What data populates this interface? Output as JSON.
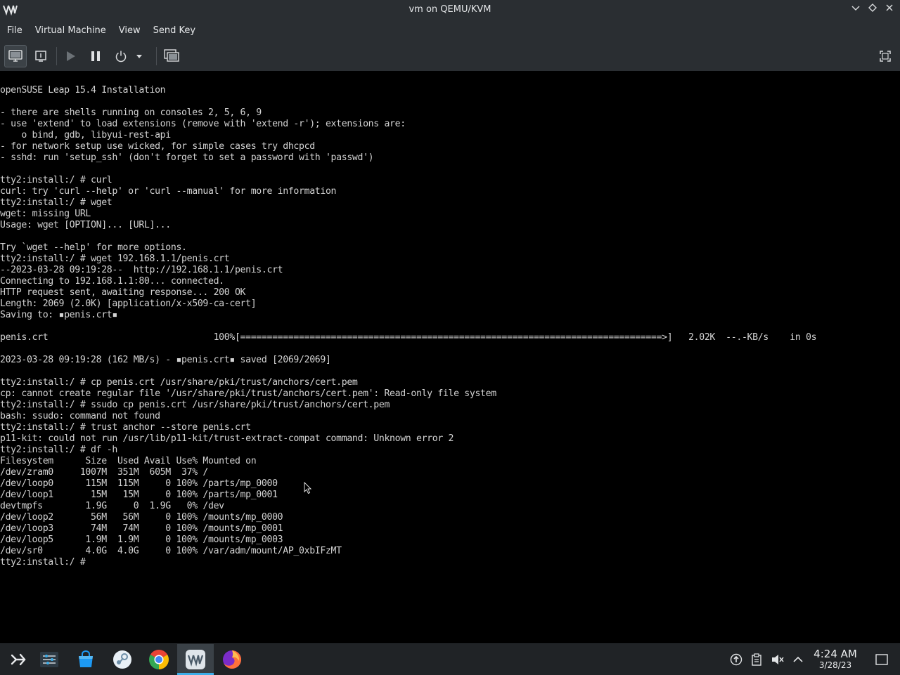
{
  "window": {
    "title": "vm on QEMU/KVM"
  },
  "menu": {
    "items": [
      "File",
      "Virtual Machine",
      "View",
      "Send Key"
    ]
  },
  "toolbar": {
    "buttons": [
      "console-view",
      "details-view",
      "run",
      "pause",
      "shutdown",
      "shutdown-menu",
      "snapshots",
      "fullscreen"
    ]
  },
  "console": {
    "lines": [
      "openSUSE Leap 15.4 Installation",
      "",
      "- there are shells running on consoles 2, 5, 6, 9",
      "- use 'extend' to load extensions (remove with 'extend -r'); extensions are:",
      "    o bind, gdb, libyui-rest-api",
      "- for network setup use wicked, for simple cases try dhcpcd",
      "- sshd: run 'setup_ssh' (don't forget to set a password with 'passwd')",
      "",
      "tty2:install:/ # curl",
      "curl: try 'curl --help' or 'curl --manual' for more information",
      "tty2:install:/ # wget",
      "wget: missing URL",
      "Usage: wget [OPTION]... [URL]...",
      "",
      "Try `wget --help' for more options.",
      "tty2:install:/ # wget 192.168.1.1/penis.crt",
      "--2023-03-28 09:19:28--  http://192.168.1.1/penis.crt",
      "Connecting to 192.168.1.1:80... connected.",
      "HTTP request sent, awaiting response... 200 OK",
      "Length: 2069 (2.0K) [application/x-x509-ca-cert]",
      "Saving to: ▪penis.crt▪",
      "",
      "penis.crt                               100%[===============================================================================>]   2.02K  --.-KB/s    in 0s",
      "",
      "2023-03-28 09:19:28 (162 MB/s) - ▪penis.crt▪ saved [2069/2069]",
      "",
      "tty2:install:/ # cp penis.crt /usr/share/pki/trust/anchors/cert.pem",
      "cp: cannot create regular file '/usr/share/pki/trust/anchors/cert.pem': Read-only file system",
      "tty2:install:/ # ssudo cp penis.crt /usr/share/pki/trust/anchors/cert.pem",
      "bash: ssudo: command not found",
      "tty2:install:/ # trust anchor --store penis.crt",
      "p11-kit: could not run /usr/lib/p11-kit/trust-extract-compat command: Unknown error 2",
      "tty2:install:/ # df -h",
      "Filesystem      Size  Used Avail Use% Mounted on",
      "/dev/zram0     1007M  351M  605M  37% /",
      "/dev/loop0      115M  115M     0 100% /parts/mp_0000",
      "/dev/loop1       15M   15M     0 100% /parts/mp_0001",
      "devtmpfs        1.9G     0  1.9G   0% /dev",
      "/dev/loop2       56M   56M     0 100% /mounts/mp_0000",
      "/dev/loop3       74M   74M     0 100% /mounts/mp_0001",
      "/dev/loop5      1.9M  1.9M     0 100% /mounts/mp_0003",
      "/dev/sr0        4.0G  4.0G     0 100% /var/adm/mount/AP_0xbIFzMT",
      "tty2:install:/ # "
    ]
  },
  "taskbar": {
    "apps": [
      "app-launcher",
      "system-settings",
      "discover",
      "steam",
      "chrome",
      "virt-manager",
      "firefox"
    ],
    "clock": {
      "time": "4:24 AM",
      "date": "3/28/23"
    }
  },
  "colors": {
    "chrome": "#2a2e32",
    "taskbar": "#202326",
    "accent": "#3daee9",
    "console_text": "#d3d3d3"
  }
}
